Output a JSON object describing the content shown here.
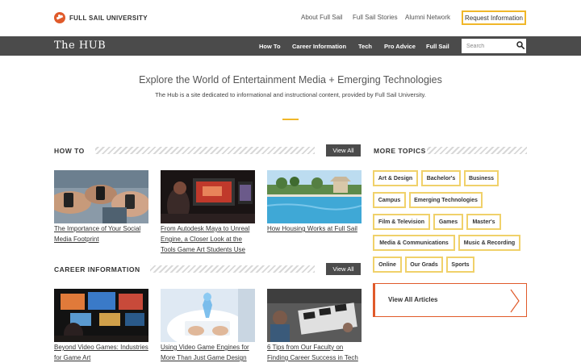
{
  "header": {
    "brand": "FULL SAIL UNIVERSITY",
    "links": [
      "About Full Sail",
      "Full Sail Stories",
      "Alumni Network"
    ],
    "request_info": "Request Information"
  },
  "nav": {
    "site_title": "The HUB",
    "items": [
      "How To",
      "Career Information",
      "Tech",
      "Pro Advice",
      "Full Sail"
    ],
    "search_placeholder": "Search"
  },
  "hero": {
    "title": "Explore the World of Entertainment Media + Emerging Technologies",
    "subtitle": "The Hub is a site dedicated to informational and instructional content, provided by Full Sail University."
  },
  "how_to": {
    "heading": "HOW TO",
    "view_all": "View All",
    "articles": [
      {
        "title": "The Importance of Your Social Media Footprint"
      },
      {
        "title": "From Autodesk Maya to Unreal Engine, a Closer Look at the Tools Game Art Students Use"
      },
      {
        "title": "How Housing Works at Full Sail"
      }
    ]
  },
  "career_info": {
    "heading": "CAREER INFORMATION",
    "view_all": "View All",
    "articles": [
      {
        "title": "Beyond Video Games: Industries for Game Art"
      },
      {
        "title": "Using Video Game Engines for More Than Just Game Design"
      },
      {
        "title": "6 Tips from Our Faculty on Finding Career Success in Tech"
      }
    ]
  },
  "more_topics": {
    "heading": "MORE TOPICS",
    "tags": [
      "Art & Design",
      "Bachelor's",
      "Business",
      "Campus",
      "Emerging Technologies",
      "Film & Television",
      "Games",
      "Master's",
      "Media & Communications",
      "Music & Recording",
      "Online",
      "Our Grads",
      "Sports"
    ],
    "view_all_articles": "View All Articles"
  },
  "colors": {
    "accent": "#f0b729",
    "brand_orange": "#e05a2a",
    "nav_bg": "#4b4b4b"
  }
}
